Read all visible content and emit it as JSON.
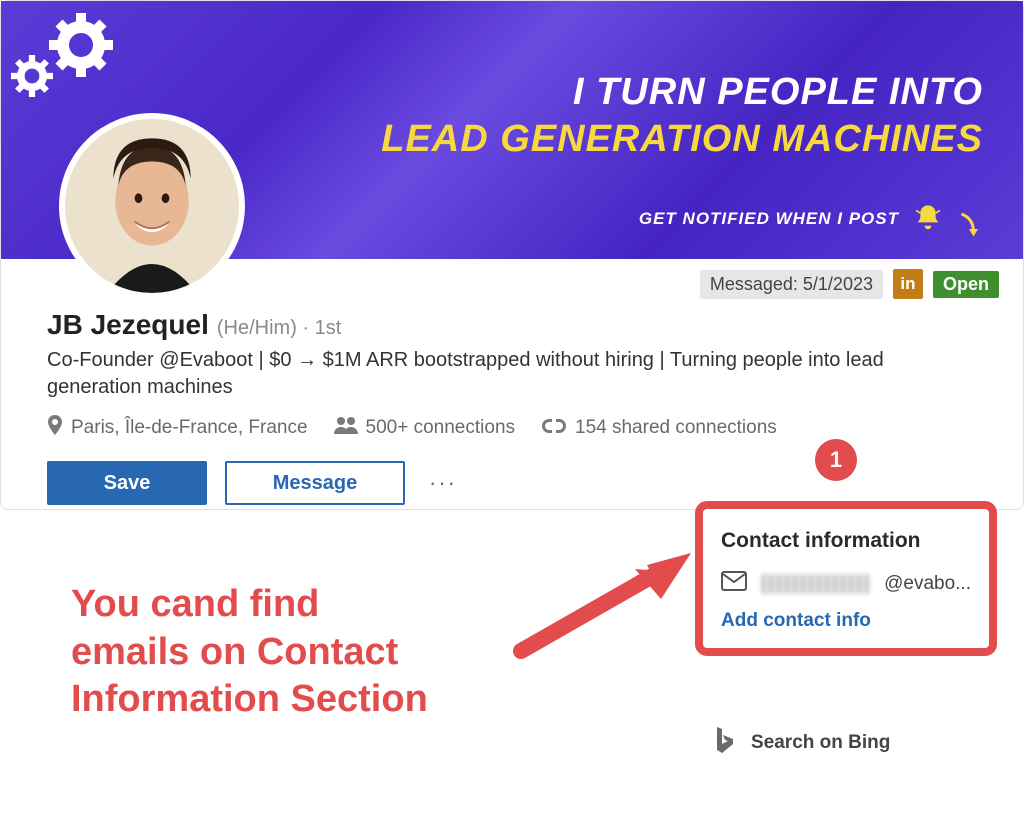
{
  "banner": {
    "tagline_line1": "I TURN PEOPLE INTO",
    "tagline_line2": "LEAD GENERATION MACHINES",
    "notify_text": "GET NOTIFIED WHEN I POST"
  },
  "status": {
    "messaged_label": "Messaged: 5/1/2023",
    "in_label": "in",
    "open_label": "Open"
  },
  "profile": {
    "name": "JB Jezequel",
    "pronoun_degree": "(He/Him) · 1st",
    "headline": "Co-Founder @Evaboot | $0 → $1M ARR bootstrapped without hiring | Turning people into lead generation machines",
    "location": "Paris, Île-de-France, France",
    "connections": "500+ connections",
    "shared": "154 shared connections"
  },
  "buttons": {
    "save": "Save",
    "message": "Message",
    "more": "···"
  },
  "contact": {
    "title": "Contact information",
    "email_suffix": "@evabo...",
    "add_link": "Add contact info"
  },
  "bing": {
    "label": "Search on Bing"
  },
  "annotation": {
    "text_line1": "You cand find",
    "text_line2": "emails on Contact",
    "text_line3": "Information Section",
    "badge": "1"
  }
}
